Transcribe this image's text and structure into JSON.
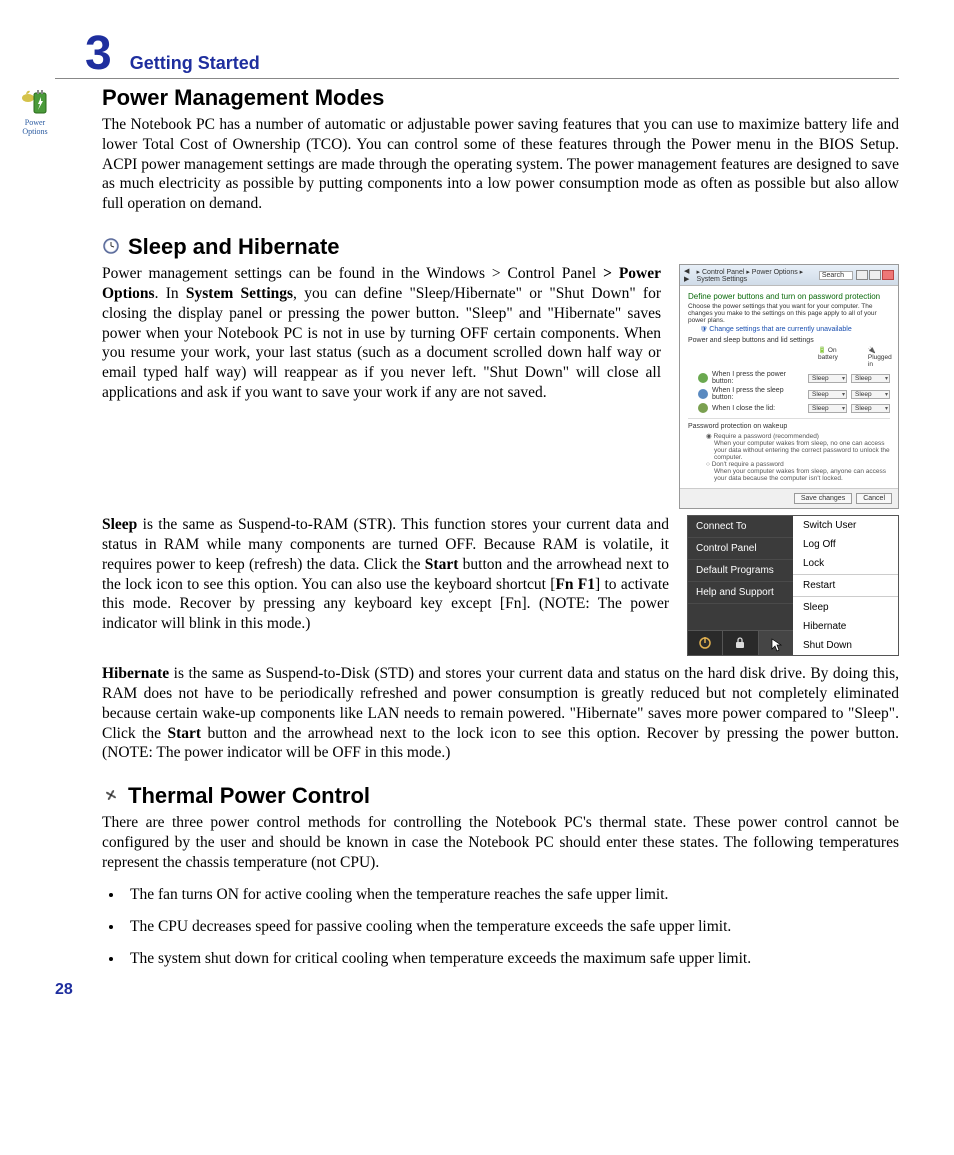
{
  "header": {
    "chapter_number": "3",
    "chapter_title": "Getting Started"
  },
  "icon_label": {
    "line1": "Power",
    "line2": "Options"
  },
  "section1": {
    "heading": "Power Management Modes",
    "para": "The Notebook PC has a number of automatic or adjustable power saving features that you can use to maximize battery life and lower Total Cost of Ownership (TCO). You can control some of these features through the Power menu in the BIOS Setup. ACPI power management settings are made through the operating system. The power management features are designed to save as much electricity as possible by putting components into a low power consumption mode as often as possible but also allow full operation on demand."
  },
  "section2": {
    "heading": "Sleep and Hibernate",
    "para1_pre": "Power management settings can be found in the Windows > Control Panel ",
    "para1_b1": "> Power Options",
    "para1_mid1": ". In ",
    "para1_b2": "System Settings",
    "para1_post": ", you can define \"Sleep/Hibernate\" or \"Shut Down\" for closing the display panel or pressing the power button. \"Sleep\" and \"Hibernate\" saves power when your Notebook PC is not in use by turning OFF certain components. When you resume your work, your last status (such as a document scrolled down half way or email typed half way) will reappear as if you never left. \"Shut Down\" will close all applications and ask if you want to save your work if any are not saved.",
    "para2_b1": "Sleep",
    "para2_mid1": " is the same as Suspend-to-RAM (STR). This function stores your current data and status in RAM while many components are turned OFF. Because RAM is volatile, it requires power to keep (refresh) the data. Click the ",
    "para2_b2": "Start",
    "para2_mid2": " button and the arrowhead next to the lock icon to see this option. You can also use the keyboard shortcut [",
    "para2_b3": "Fn F1",
    "para2_post": "] to activate this mode. Recover by pressing any keyboard key except [Fn]. (NOTE: The power indicator will blink in this mode.)",
    "para3_b1": "Hibernate",
    "para3_mid1": " is the same as  Suspend-to-Disk (STD) and stores your current data and status on the hard disk drive. By doing this, RAM does not have to be periodically refreshed and power consumption is greatly reduced but not completely eliminated because certain wake-up components like LAN needs to remain powered. \"Hibernate\" saves more power compared to \"Sleep\". Click the ",
    "para3_b2": "Start",
    "para3_post": " button and the arrowhead next to the lock icon to see this option. Recover by pressing the power button. (NOTE: The power indicator will be OFF in this mode.)"
  },
  "section3": {
    "heading": "Thermal Power Control",
    "para": "There are three power control methods for controlling the Notebook PC's thermal state. These power control cannot be configured by the user and should be known in case the Notebook PC should enter these states. The following temperatures represent the chassis temperature (not CPU).",
    "bullets": [
      "The fan turns ON for active cooling when the temperature reaches the safe upper limit.",
      "The CPU decreases speed for passive cooling when the temperature exceeds the safe upper limit.",
      "The system shut down for critical cooling when temperature exceeds the maximum safe upper limit."
    ]
  },
  "screenshot1": {
    "breadcrumb": "▸ Control Panel ▸ Power Options ▸ System Settings",
    "search": "Search",
    "heading": "Define power buttons and turn on password protection",
    "desc": "Choose the power settings that you want for your computer. The changes you make to the settings on this page apply to all of your power plans.",
    "link": "Change settings that are currently unavailable",
    "sub": "Power and sleep buttons and lid settings",
    "col1": "On battery",
    "col2": "Plugged in",
    "row1": "When I press the power button:",
    "row2": "When I press the sleep button:",
    "row3": "When I close the lid:",
    "opt": "Sleep",
    "prot": "Password protection on wakeup",
    "radio1": "Require a password (recommended)",
    "note1": "When your computer wakes from sleep, no one can access your data without entering the correct password to unlock the computer.",
    "radio2": "Don't require a password",
    "note2": "When your computer wakes from sleep, anyone can access your data because the computer isn't locked.",
    "btn_save": "Save changes",
    "btn_cancel": "Cancel"
  },
  "startmenu": {
    "left": [
      "Connect To",
      "Control Panel",
      "Default Programs",
      "Help and Support"
    ],
    "right": [
      "Switch User",
      "Log Off",
      "Lock",
      "Restart",
      "Sleep",
      "Hibernate",
      "Shut Down"
    ]
  },
  "page_number": "28"
}
